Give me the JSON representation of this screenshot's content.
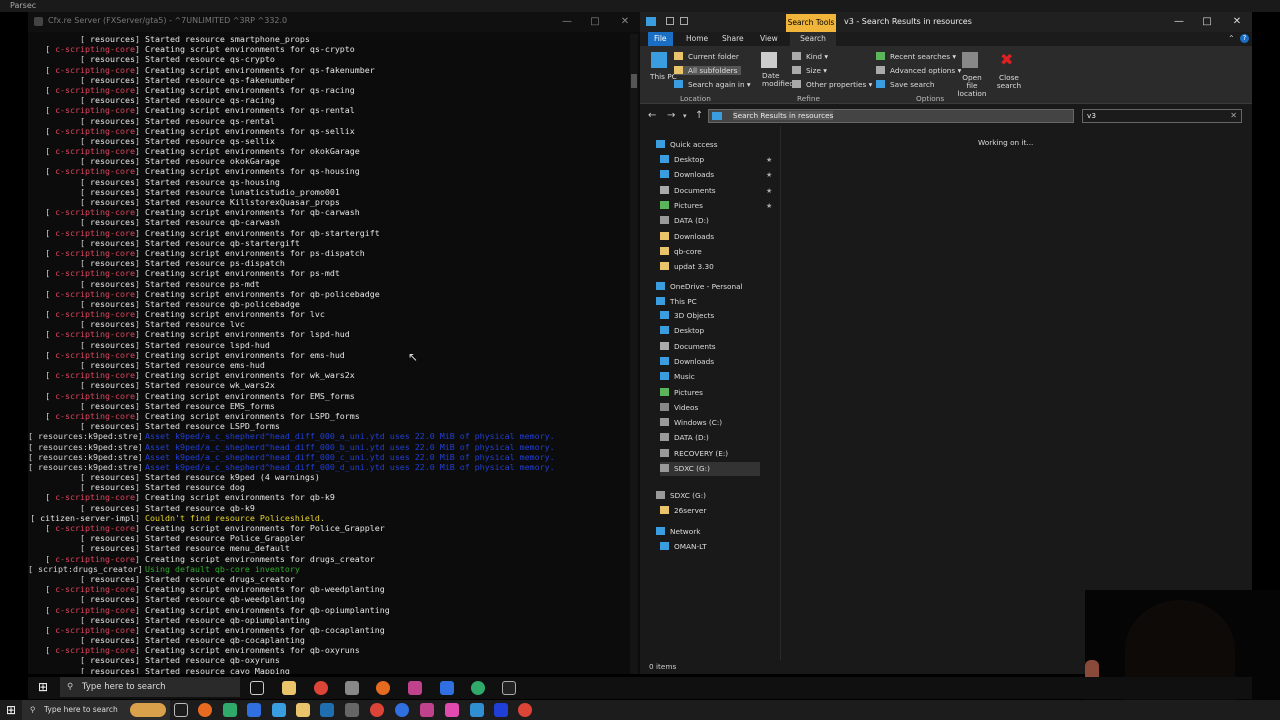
{
  "parsec": {
    "title": "Parsec"
  },
  "console": {
    "title": "Cfx.re Server (FXServer/gta5) - ^7UNLIMITED ^3RP ^332.0",
    "lines": [
      {
        "tag": "resources",
        "text": "Started resource smartphone_props",
        "kind": "res"
      },
      {
        "tag": "c-scripting-core",
        "text": "Creating script environments for qs-crypto",
        "kind": "core"
      },
      {
        "tag": "resources",
        "text": "Started resource qs-crypto",
        "kind": "res"
      },
      {
        "tag": "c-scripting-core",
        "text": "Creating script environments for qs-fakenumber",
        "kind": "core"
      },
      {
        "tag": "resources",
        "text": "Started resource qs-fakenumber",
        "kind": "res"
      },
      {
        "tag": "c-scripting-core",
        "text": "Creating script environments for qs-racing",
        "kind": "core"
      },
      {
        "tag": "resources",
        "text": "Started resource qs-racing",
        "kind": "res"
      },
      {
        "tag": "c-scripting-core",
        "text": "Creating script environments for qs-rental",
        "kind": "core"
      },
      {
        "tag": "resources",
        "text": "Started resource qs-rental",
        "kind": "res"
      },
      {
        "tag": "c-scripting-core",
        "text": "Creating script environments for qs-sellix",
        "kind": "core"
      },
      {
        "tag": "resources",
        "text": "Started resource qs-sellix",
        "kind": "res"
      },
      {
        "tag": "c-scripting-core",
        "text": "Creating script environments for okokGarage",
        "kind": "core"
      },
      {
        "tag": "resources",
        "text": "Started resource okokGarage",
        "kind": "res"
      },
      {
        "tag": "c-scripting-core",
        "text": "Creating script environments for qs-housing",
        "kind": "core"
      },
      {
        "tag": "resources",
        "text": "Started resource qs-housing",
        "kind": "res"
      },
      {
        "tag": "resources",
        "text": "Started resource lunaticstudio_promo001",
        "kind": "res"
      },
      {
        "tag": "resources",
        "text": "Started resource KillstorexQuasar_props",
        "kind": "res"
      },
      {
        "tag": "c-scripting-core",
        "text": "Creating script environments for qb-carwash",
        "kind": "core"
      },
      {
        "tag": "resources",
        "text": "Started resource qb-carwash",
        "kind": "res"
      },
      {
        "tag": "c-scripting-core",
        "text": "Creating script environments for qb-startergift",
        "kind": "core"
      },
      {
        "tag": "resources",
        "text": "Started resource qb-startergift",
        "kind": "res"
      },
      {
        "tag": "c-scripting-core",
        "text": "Creating script environments for ps-dispatch",
        "kind": "core"
      },
      {
        "tag": "resources",
        "text": "Started resource ps-dispatch",
        "kind": "res"
      },
      {
        "tag": "c-scripting-core",
        "text": "Creating script environments for ps-mdt",
        "kind": "core"
      },
      {
        "tag": "resources",
        "text": "Started resource ps-mdt",
        "kind": "res"
      },
      {
        "tag": "c-scripting-core",
        "text": "Creating script environments for qb-policebadge",
        "kind": "core"
      },
      {
        "tag": "resources",
        "text": "Started resource qb-policebadge",
        "kind": "res"
      },
      {
        "tag": "c-scripting-core",
        "text": "Creating script environments for lvc",
        "kind": "core"
      },
      {
        "tag": "resources",
        "text": "Started resource lvc",
        "kind": "res"
      },
      {
        "tag": "c-scripting-core",
        "text": "Creating script environments for lspd-hud",
        "kind": "core"
      },
      {
        "tag": "resources",
        "text": "Started resource lspd-hud",
        "kind": "res"
      },
      {
        "tag": "c-scripting-core",
        "text": "Creating script environments for ems-hud",
        "kind": "core"
      },
      {
        "tag": "resources",
        "text": "Started resource ems-hud",
        "kind": "res"
      },
      {
        "tag": "c-scripting-core",
        "text": "Creating script environments for wk_wars2x",
        "kind": "core"
      },
      {
        "tag": "resources",
        "text": "Started resource wk_wars2x",
        "kind": "res"
      },
      {
        "tag": "c-scripting-core",
        "text": "Creating script environments for EMS_forms",
        "kind": "core"
      },
      {
        "tag": "resources",
        "text": "Started resource EMS_forms",
        "kind": "res"
      },
      {
        "tag": "c-scripting-core",
        "text": "Creating script environments for LSPD_forms",
        "kind": "core"
      },
      {
        "tag": "resources",
        "text": "Started resource LSPD_forms",
        "kind": "res"
      },
      {
        "tag": "resources:k9ped:stre",
        "text": "Asset k9ped/a_c_shepherd^head_diff_000_a_uni.ytd uses 22.0 MiB of physical memory.",
        "kind": "blue"
      },
      {
        "tag": "resources:k9ped:stre",
        "text": "Asset k9ped/a_c_shepherd^head_diff_000_b_uni.ytd uses 22.0 MiB of physical memory.",
        "kind": "blue"
      },
      {
        "tag": "resources:k9ped:stre",
        "text": "Asset k9ped/a_c_shepherd^head_diff_000_c_uni.ytd uses 22.0 MiB of physical memory.",
        "kind": "blue"
      },
      {
        "tag": "resources:k9ped:stre",
        "text": "Asset k9ped/a_c_shepherd^head_diff_000_d_uni.ytd uses 22.0 MiB of physical memory.",
        "kind": "blue"
      },
      {
        "tag": "resources",
        "text": "Started resource k9ped (4 warnings)",
        "kind": "res"
      },
      {
        "tag": "resources",
        "text": "Started resource dog",
        "kind": "res"
      },
      {
        "tag": "c-scripting-core",
        "text": "Creating script environments for qb-k9",
        "kind": "core"
      },
      {
        "tag": "resources",
        "text": "Started resource qb-k9",
        "kind": "res"
      },
      {
        "tag": "citizen-server-impl",
        "text": "Couldn't find resource Policeshield.",
        "kind": "yel"
      },
      {
        "tag": "c-scripting-core",
        "text": "Creating script environments for Police_Grappler",
        "kind": "core"
      },
      {
        "tag": "resources",
        "text": "Started resource Police_Grappler",
        "kind": "res"
      },
      {
        "tag": "resources",
        "text": "Started resource menu_default",
        "kind": "res"
      },
      {
        "tag": "c-scripting-core",
        "text": "Creating script environments for drugs_creator",
        "kind": "core"
      },
      {
        "tag": "script:drugs_creator",
        "text": "Using default qb-core inventory",
        "kind": "grn"
      },
      {
        "tag": "resources",
        "text": "Started resource drugs_creator",
        "kind": "res"
      },
      {
        "tag": "c-scripting-core",
        "text": "Creating script environments for qb-weedplanting",
        "kind": "core"
      },
      {
        "tag": "resources",
        "text": "Started resource qb-weedplanting",
        "kind": "res"
      },
      {
        "tag": "c-scripting-core",
        "text": "Creating script environments for qb-opiumplanting",
        "kind": "core"
      },
      {
        "tag": "resources",
        "text": "Started resource qb-opiumplanting",
        "kind": "res"
      },
      {
        "tag": "c-scripting-core",
        "text": "Creating script environments for qb-cocaplanting",
        "kind": "core"
      },
      {
        "tag": "resources",
        "text": "Started resource qb-cocaplanting",
        "kind": "res"
      },
      {
        "tag": "c-scripting-core",
        "text": "Creating script environments for qb-oxyruns",
        "kind": "core"
      },
      {
        "tag": "resources",
        "text": "Started resource qb-oxyruns",
        "kind": "res"
      },
      {
        "tag": "resources",
        "text": "Started resource cayo_Mapping",
        "kind": "res"
      }
    ]
  },
  "explorer": {
    "title": "v3 - Search Results in resources",
    "search_tools_tab": "Search Tools",
    "tabs": [
      "File",
      "Home",
      "Share",
      "View",
      "Search"
    ],
    "ribbon": {
      "this_pc": "This PC",
      "current_folder": "Current folder",
      "all_subfolders": "All subfolders",
      "search_again_in": "Search again in",
      "location_group": "Location",
      "date_modified": "Date modified",
      "kind": "Kind",
      "size": "Size",
      "other_properties": "Other properties",
      "refine_group": "Refine",
      "recent_searches": "Recent searches",
      "advanced_options": "Advanced options",
      "save_search": "Save search",
      "open_file_location": "Open file location",
      "close_search": "Close search",
      "options_group": "Options"
    },
    "address": "Search Results in resources",
    "search_value": "v3",
    "working_text": "Working on it...",
    "status": "0 items",
    "nav": {
      "quick_access": "Quick access",
      "quick_items": [
        "Desktop",
        "Downloads",
        "Documents",
        "Pictures",
        "DATA (D:)",
        "Downloads",
        "qb-core",
        "updat 3.30"
      ],
      "onedrive": "OneDrive - Personal",
      "this_pc": "This PC",
      "pc_items": [
        "3D Objects",
        "Desktop",
        "Documents",
        "Downloads",
        "Music",
        "Pictures",
        "Videos",
        "Windows (C:)",
        "DATA (D:)",
        "RECOVERY (E:)",
        "SDXC (G:)"
      ],
      "sdxc": "SDXC (G:)",
      "sdxc_child": "26server",
      "network": "Network",
      "network_child": "OMAN-LT"
    }
  },
  "taskbar": {
    "search_placeholder": "Type here to search"
  },
  "taskbar2": {
    "search_placeholder": "Type here to search"
  },
  "colors": {
    "core_red": "#e0455f",
    "asset_blue": "#1f3fd6",
    "warn_yellow": "#e8d62a",
    "accent_blue": "#1a6fc4",
    "search_tools_gold": "#f0b53a"
  }
}
